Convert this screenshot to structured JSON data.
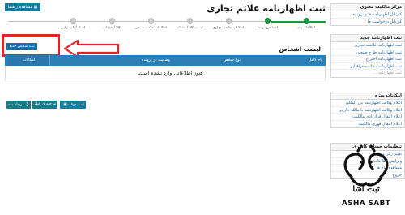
{
  "header": {
    "page_title": "ثبت اظهارنامه علائم تجاری",
    "show_guide_label": "مشاهده راهنما"
  },
  "stepper": {
    "steps": [
      {
        "label": "اطلاعات پایه"
      },
      {
        "label": "اشخاص مرتبط"
      },
      {
        "label": "اطلاعات علامت تجاری"
      },
      {
        "label": "لیست کالا / خدمات"
      },
      {
        "label": "اطلاعات علامت صنعتی"
      },
      {
        "label": "کالا / خدمات"
      },
      {
        "label": "اسناد / تایید نهایی"
      }
    ]
  },
  "sidebar": {
    "box1": {
      "title": "مرکز مالکیت معنوی",
      "items": [
        {
          "label": "کارتابل اظهارنامه ها و پرونده"
        },
        {
          "label": "کارتابل درخواست ها"
        }
      ]
    },
    "box2": {
      "title": "ثبت اظهارنامه جدید",
      "items": [
        {
          "label": "ثبت اظهارنامه علامت تجاری"
        },
        {
          "label": "ثبت اظهارنامه طرح صنعتی"
        },
        {
          "label": "ثبت اظهارنامه اختراع"
        },
        {
          "label": "ثبت اظهارنامه نشانه جغرافیایی"
        },
        {
          "label": "ثبت اظهارنامه ..."
        }
      ]
    },
    "box3": {
      "title": "امکانات ویژه",
      "items": [
        {
          "label": "اعلام وکالت اظهارنامه بین المللی"
        },
        {
          "label": "اعلام وکالت اظهارنامه با مالک خارجی"
        },
        {
          "label": "اعلام انتقال قراردادی مالکیت"
        },
        {
          "label": "اعلام انتقال قهری مالکیت"
        }
      ]
    },
    "box4": {
      "title": "تنظیمات حساب کاربری",
      "items": [
        {
          "label": "تغییر رمز عبور"
        },
        {
          "label": "ویرایش اطلاعات"
        },
        {
          "label": "مشاهده پیام ها"
        },
        {
          "label": "خروج"
        }
      ]
    }
  },
  "main": {
    "section_title": "لیست اشخاص",
    "new_person_label": "ثبت شخص جدید",
    "table": {
      "columns": {
        "name": "نام کامل",
        "type": "نوع شخص",
        "status": "وضعیت در پرونده",
        "actions": "امکانات"
      },
      "empty_text": "هنوز اطلاعاتی وارد نشده است."
    },
    "buttons": {
      "next": "مرحله بعد",
      "prev": "مرحله ی قبلی",
      "save": "ثبت موقت"
    }
  },
  "watermark": {
    "text_fa": "ثبت آشا",
    "text_en": "ASHA SABT"
  },
  "colors": {
    "table_header": "#2c7fb4",
    "button": "#1a7a8a",
    "stepper_done": "#1a9a3f",
    "annotation": "#e32222",
    "link": "#1c5f9a"
  }
}
